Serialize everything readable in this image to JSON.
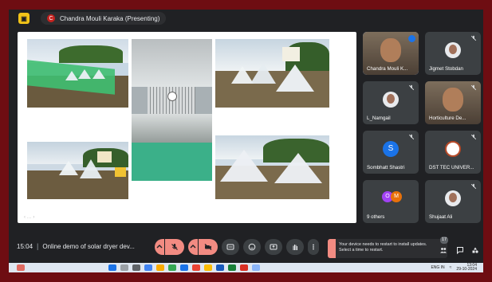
{
  "app": {
    "presenter_chip": "Chandra Mouli Karaka (Presenting)",
    "presenter_initial": "C",
    "logo_glyph": "▣"
  },
  "slide": {
    "footer_text": "‹ … ›"
  },
  "participants": [
    {
      "name": "Chandra Mouli K...",
      "speaking": true,
      "kind": "photo",
      "color": "#8ab4f8"
    },
    {
      "name": "Jigmet Stobdan",
      "speaking": false,
      "kind": "avatar",
      "color": "#3c4043"
    },
    {
      "name": "L_Namgail",
      "speaking": false,
      "kind": "avatar",
      "color": "#3c4043"
    },
    {
      "name": "Horticulture De...",
      "speaking": false,
      "kind": "photo",
      "color": "#3c4043"
    },
    {
      "name": "Sombhatt Shastri",
      "speaking": false,
      "kind": "letter",
      "letter": "S",
      "color": "#1a73e8"
    },
    {
      "name": "DST TEC UNIVER...",
      "speaking": false,
      "kind": "seal",
      "color": "#3c4043"
    },
    {
      "name": "9 others",
      "speaking": false,
      "kind": "others",
      "color": "#3c4043"
    },
    {
      "name": "Shujaat Ali",
      "speaking": false,
      "kind": "avatar",
      "color": "#3c4043"
    }
  ],
  "others_letters": [
    "O",
    "M"
  ],
  "meeting": {
    "time": "15:04",
    "separator": "|",
    "title": "Online demo of solar dryer dev...",
    "participant_count": "17"
  },
  "toast": {
    "line1": "Your device needs to restart to install updates.",
    "line2": "Select a time to restart."
  },
  "tray": {
    "lang": "ENG",
    "region": "IN",
    "time": "13:04",
    "date": "29-10-2024"
  },
  "colors": {
    "meet_bg": "#202124",
    "control_red": "#f28b82",
    "control_gray": "#3c4043",
    "frame": "#6e0d12",
    "taskbar": "#dfe7f1"
  },
  "icons": [
    "mic-off-icon",
    "camera-off-icon",
    "captions-icon",
    "emoji-icon",
    "present-icon",
    "raise-hand-icon",
    "more-icon",
    "people-icon",
    "chat-icon",
    "activities-icon"
  ]
}
